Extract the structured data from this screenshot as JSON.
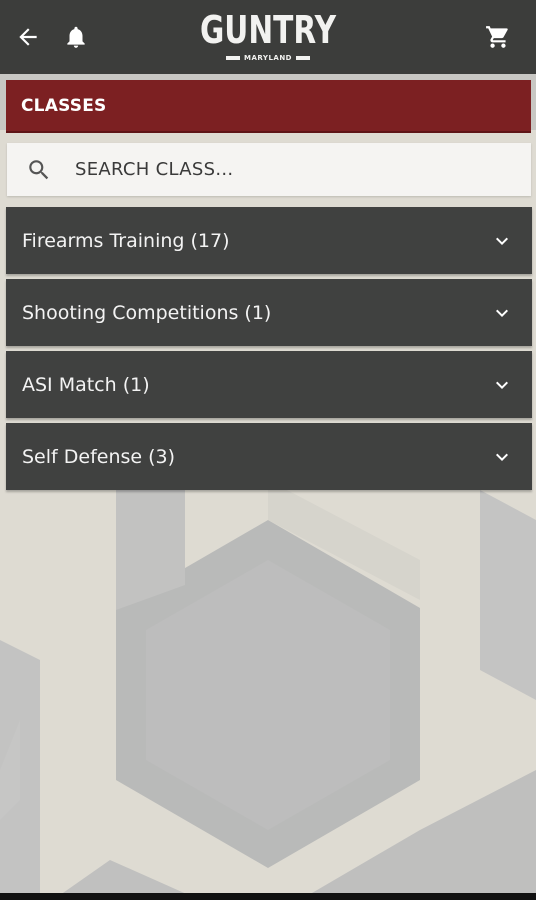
{
  "header": {
    "logo_text": "GUNTRY",
    "logo_subtext": "MARYLAND",
    "back_icon": "back-arrow-icon",
    "notification_icon": "bell-icon",
    "cart_icon": "cart-icon"
  },
  "section": {
    "title": "CLASSES"
  },
  "search": {
    "placeholder": "SEARCH CLASS..."
  },
  "categories": [
    {
      "label": "Firearms Training (17)"
    },
    {
      "label": "Shooting Competitions (1)"
    },
    {
      "label": "ASI Match (1)"
    },
    {
      "label": "Self Defense (3)"
    }
  ],
  "colors": {
    "topbar": "#3c3d3b",
    "section_header": "#7c2022",
    "category_bg": "#404140",
    "background": "#dedbd2"
  }
}
